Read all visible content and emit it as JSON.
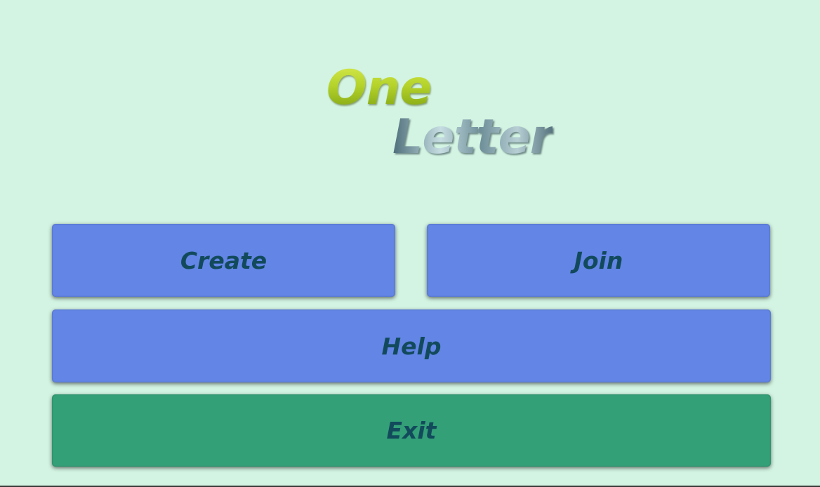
{
  "logo": {
    "line1": "One",
    "line2": "Letter"
  },
  "menu": {
    "create_label": "Create",
    "join_label": "Join",
    "help_label": "Help",
    "exit_label": "Exit"
  },
  "colors": {
    "background": "#d3f4e2",
    "primary_button": "#6285e6",
    "exit_button": "#33a078",
    "button_text": "#124a5c",
    "logo_one": "#b4d22a",
    "logo_letter": "#6f8f99"
  }
}
